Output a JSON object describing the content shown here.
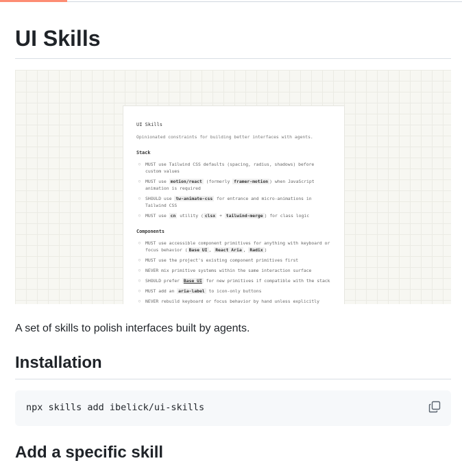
{
  "header": {
    "title": "UI Skills"
  },
  "preview": {
    "title": "UI Skills",
    "subtitle": "Opinionated constraints for building better interfaces with agents.",
    "sections": [
      {
        "heading": "Stack",
        "items": [
          [
            "MUST use Tailwind CSS defaults (spacing, radius, shadows) before custom values"
          ],
          [
            "MUST use ",
            {
              "code": "motion/react"
            },
            " (formerly ",
            {
              "code": "framer-motion"
            },
            ") when JavaScript animation is required"
          ],
          [
            "SHOULD use ",
            {
              "code": "tw-animate-css"
            },
            " for entrance and micro-animations in Tailwind CSS"
          ],
          [
            "MUST use ",
            {
              "code": "cn"
            },
            " utility (",
            {
              "code": "clsx"
            },
            " + ",
            {
              "code": "tailwind-merge"
            },
            ") for class logic"
          ]
        ]
      },
      {
        "heading": "Components",
        "items": [
          [
            "MUST use accessible component primitives for anything with keyboard or focus behavior (",
            {
              "code": "Base UI"
            },
            ", ",
            {
              "code": "React Aria"
            },
            ", ",
            {
              "code": "Radix"
            },
            ")"
          ],
          [
            "MUST use the project's existing component primitives first"
          ],
          [
            "NEVER mix primitive systems within the same interaction surface"
          ],
          [
            "SHOULD prefer ",
            {
              "code": "Base UI",
              "link": true
            },
            " for new primitives if compatible with the stack"
          ],
          [
            "MUST add an ",
            {
              "code": "aria-label"
            },
            " to icon-only buttons"
          ],
          [
            "NEVER rebuild keyboard or focus behavior by hand unless explicitly requested"
          ]
        ]
      }
    ]
  },
  "description": "A set of skills to polish interfaces built by agents.",
  "installation": {
    "heading": "Installation",
    "command": "npx skills add ibelick/ui-skills"
  },
  "add_skill": {
    "heading": "Add a specific skill"
  },
  "icons": {
    "copy": "copy-icon"
  },
  "colors": {
    "accent": "#fd8c73",
    "code_bg": "#f6f8fa",
    "rule": "#d8dee4"
  }
}
